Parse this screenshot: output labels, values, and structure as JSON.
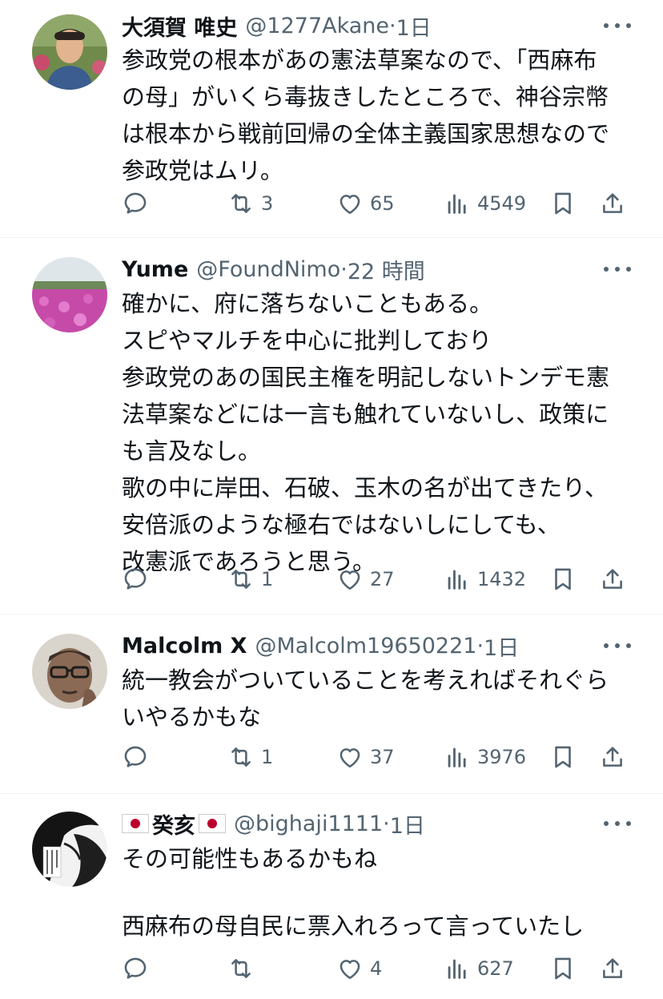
{
  "tweets": [
    {
      "name": "大須賀 唯史",
      "handle": "@1277Akane",
      "time": "1日",
      "lines": [
        "参政党の根本があの憲法草案なので、「西麻布",
        "の母」がいくら毒抜きしたところで、神谷宗幣",
        "は根本から戦前回帰の全体主義国家思想なので",
        "参政党はムリ。"
      ],
      "retweets": "3",
      "likes": "65",
      "views": "4549"
    },
    {
      "name": "Yume",
      "handle": "@FoundNimo",
      "time": "22 時間",
      "lines": [
        "確かに、府に落ちないこともある。",
        "スピやマルチを中心に批判しており",
        "参政党のあの国民主権を明記しないトンデモ憲",
        "法草案などには一言も触れていないし、政策に",
        "も言及なし。",
        "歌の中に岸田、石破、玉木の名が出てきたり、",
        "安倍派のような極右ではないしにしても、",
        "改憲派であろうと思う。"
      ],
      "retweets": "1",
      "likes": "27",
      "views": "1432"
    },
    {
      "name": "Malcolm X",
      "handle": "@Malcolm19650221",
      "time": "1日",
      "lines": [
        "統一教会がついていることを考えればそれぐら",
        "いやるかもな"
      ],
      "retweets": "1",
      "likes": "37",
      "views": "3976"
    },
    {
      "name": "癸亥",
      "handle": "@bighaji1111",
      "time": "1日",
      "lines": [
        "その可能性もあるかもね",
        "",
        "西麻布の母自民に票入れろって言っていたし"
      ],
      "retweets": "",
      "likes": "4",
      "views": "627"
    }
  ],
  "icons": {
    "reply": "reply-icon",
    "retweet": "retweet-icon",
    "like": "heart-icon",
    "views": "views-icon",
    "bookmark": "bookmark-icon",
    "share": "share-icon",
    "more": "more-icon"
  },
  "colors": {
    "text": "#0f1419",
    "secondary": "#536471",
    "divider": "#eff3f4",
    "flag_red": "#bc002d"
  }
}
